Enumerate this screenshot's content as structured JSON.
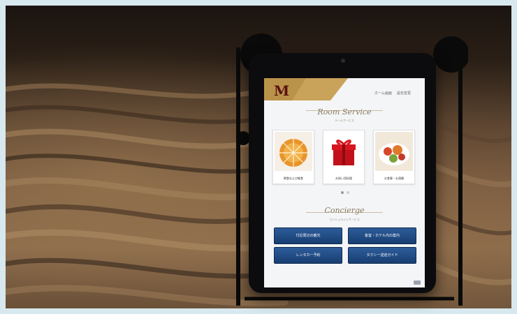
{
  "header": {
    "logo_text": "M",
    "link_1": "ホーム画面",
    "link_2": "設定変更"
  },
  "room_service": {
    "title": "Room Service",
    "subtitle": "ルームサービス",
    "items": [
      {
        "label": "朝食および軽食",
        "icon": "cake-icon"
      },
      {
        "label": "お祝い用料理",
        "icon": "gift-box-icon"
      },
      {
        "label": "お食事・お酒類",
        "icon": "dish-icon"
      }
    ]
  },
  "concierge": {
    "title": "Concierge",
    "subtitle": "コンシェルジュサービス",
    "buttons": [
      "付近周辺の観光",
      "客室・ホテル内の案内",
      "レンタカー予約",
      "タクシー送迎ガイド"
    ]
  },
  "colors": {
    "logo_gold": "#c9a35a",
    "button_blue": "#1f4c86",
    "tablet_frame": "#0c0c0e"
  }
}
